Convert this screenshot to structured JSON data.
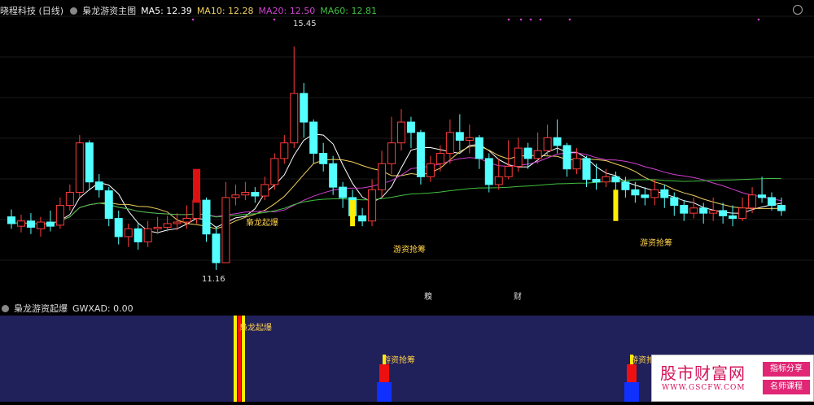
{
  "main": {
    "stock_name": "晓程科技 (日线)",
    "indicator_name": "梟龙游资主图",
    "ma": [
      {
        "label": "MA5: 12.39",
        "color": "#ffffff"
      },
      {
        "label": "MA10: 12.28",
        "color": "#f0d060"
      },
      {
        "label": "MA20: 12.50",
        "color": "#d040d0"
      },
      {
        "label": "MA60: 12.81",
        "color": "#40c040"
      }
    ],
    "high_label": "15.45",
    "low_label": "11.16",
    "signals": [
      "梟龙起爆",
      "游资抢筹",
      "游资抢筹"
    ],
    "markers": [
      "糗",
      "财"
    ]
  },
  "sub": {
    "indicator_name": "梟龙游资起爆",
    "value_label": "GWXAD: 0.00",
    "bar_labels": [
      "梟龙起爆",
      "游资抢筹",
      "游资抢"
    ]
  },
  "watermark": {
    "title": "股市财富网",
    "url": "WWW.GSCFW.COM",
    "tag1": "指标分享",
    "tag2": "名师课程"
  },
  "colors": {
    "up": "#ff3b3b",
    "down": "#54ffff",
    "bg": "#000000",
    "sub_bg": "#20205a"
  },
  "chart_data": {
    "type": "candlestick",
    "candles": [
      [
        12.18,
        12.05,
        12.32,
        11.95
      ],
      [
        12.0,
        12.1,
        12.22,
        11.88
      ],
      [
        12.1,
        11.98,
        12.25,
        11.85
      ],
      [
        11.95,
        12.08,
        12.18,
        11.8
      ],
      [
        12.08,
        12.0,
        12.3,
        11.9
      ],
      [
        12.02,
        12.4,
        12.55,
        11.95
      ],
      [
        12.4,
        12.65,
        12.8,
        12.3
      ],
      [
        12.65,
        13.6,
        13.75,
        12.55
      ],
      [
        13.6,
        12.85,
        13.65,
        12.7
      ],
      [
        12.85,
        12.7,
        13.0,
        12.55
      ],
      [
        12.68,
        12.15,
        12.75,
        12.0
      ],
      [
        12.15,
        11.8,
        12.3,
        11.65
      ],
      [
        11.8,
        11.95,
        12.05,
        11.6
      ],
      [
        11.95,
        11.7,
        12.05,
        11.55
      ],
      [
        11.7,
        11.95,
        12.1,
        11.6
      ],
      [
        11.95,
        11.98,
        12.18,
        11.85
      ],
      [
        11.98,
        12.05,
        12.2,
        11.9
      ],
      [
        12.05,
        12.08,
        12.25,
        11.92
      ],
      [
        12.08,
        12.15,
        12.4,
        11.95
      ],
      [
        12.15,
        12.5,
        12.75,
        12.05
      ],
      [
        12.5,
        11.85,
        12.55,
        11.7
      ],
      [
        11.85,
        11.3,
        12.0,
        11.16
      ],
      [
        11.3,
        12.55,
        12.85,
        11.3
      ],
      [
        12.55,
        12.6,
        12.8,
        12.4
      ],
      [
        12.6,
        12.65,
        12.85,
        12.5
      ],
      [
        12.65,
        12.58,
        12.75,
        12.45
      ],
      [
        12.58,
        12.8,
        12.95,
        12.5
      ],
      [
        12.8,
        13.3,
        13.4,
        12.7
      ],
      [
        13.3,
        13.6,
        13.75,
        13.2
      ],
      [
        13.6,
        14.55,
        15.45,
        13.5
      ],
      [
        14.55,
        14.0,
        14.75,
        13.7
      ],
      [
        14.0,
        13.4,
        14.05,
        13.2
      ],
      [
        13.4,
        13.2,
        13.6,
        13.05
      ],
      [
        13.2,
        12.75,
        13.35,
        12.6
      ],
      [
        12.75,
        12.55,
        12.85,
        12.35
      ],
      [
        12.55,
        12.2,
        12.7,
        12.05
      ],
      [
        12.2,
        12.1,
        12.35,
        12.0
      ],
      [
        12.1,
        12.7,
        12.9,
        12.0
      ],
      [
        12.7,
        13.2,
        13.45,
        12.55
      ],
      [
        13.2,
        13.6,
        14.1,
        13.0
      ],
      [
        13.6,
        14.0,
        14.25,
        13.45
      ],
      [
        14.0,
        13.8,
        14.1,
        13.5
      ],
      [
        13.8,
        12.95,
        13.85,
        12.8
      ],
      [
        12.95,
        13.2,
        13.35,
        12.85
      ],
      [
        13.2,
        13.4,
        13.55,
        13.05
      ],
      [
        13.4,
        13.8,
        14.05,
        13.2
      ],
      [
        13.8,
        13.65,
        14.15,
        13.45
      ],
      [
        13.65,
        13.7,
        13.95,
        13.4
      ],
      [
        13.7,
        13.3,
        13.75,
        13.1
      ],
      [
        13.3,
        12.8,
        13.4,
        12.65
      ],
      [
        12.8,
        12.95,
        13.3,
        12.7
      ],
      [
        12.95,
        13.15,
        13.65,
        12.9
      ],
      [
        13.15,
        13.5,
        13.7,
        13.05
      ],
      [
        13.5,
        13.3,
        13.6,
        13.1
      ],
      [
        13.3,
        13.45,
        13.8,
        13.2
      ],
      [
        13.45,
        13.7,
        13.95,
        13.35
      ],
      [
        13.7,
        13.55,
        14.05,
        13.4
      ],
      [
        13.55,
        13.1,
        13.6,
        12.95
      ],
      [
        13.1,
        13.3,
        13.5,
        13.0
      ],
      [
        13.3,
        12.9,
        13.35,
        12.75
      ],
      [
        12.9,
        12.85,
        13.2,
        12.7
      ],
      [
        12.85,
        12.95,
        13.1,
        12.75
      ],
      [
        12.95,
        12.85,
        13.05,
        12.65
      ],
      [
        12.85,
        12.7,
        12.95,
        12.55
      ],
      [
        12.7,
        12.6,
        12.85,
        12.45
      ],
      [
        12.6,
        12.55,
        12.75,
        12.4
      ],
      [
        12.55,
        12.7,
        12.9,
        12.4
      ],
      [
        12.7,
        12.55,
        12.8,
        12.35
      ],
      [
        12.55,
        12.4,
        12.65,
        12.2
      ],
      [
        12.4,
        12.25,
        12.5,
        12.1
      ],
      [
        12.25,
        12.35,
        12.55,
        12.15
      ],
      [
        12.35,
        12.25,
        12.45,
        12.05
      ],
      [
        12.25,
        12.3,
        12.55,
        12.1
      ],
      [
        12.3,
        12.2,
        12.45,
        12.05
      ],
      [
        12.2,
        12.15,
        12.4,
        12.0
      ],
      [
        12.15,
        12.35,
        12.55,
        12.1
      ],
      [
        12.35,
        12.6,
        12.75,
        12.25
      ],
      [
        12.6,
        12.55,
        12.95,
        12.45
      ],
      [
        12.55,
        12.4,
        12.65,
        12.3
      ],
      [
        12.4,
        12.3,
        12.55,
        12.2
      ]
    ],
    "ylim": [
      10.8,
      16.0
    ],
    "last": {
      "MA5": 12.39,
      "MA10": 12.28,
      "MA20": 12.5,
      "MA60": 12.81
    }
  }
}
